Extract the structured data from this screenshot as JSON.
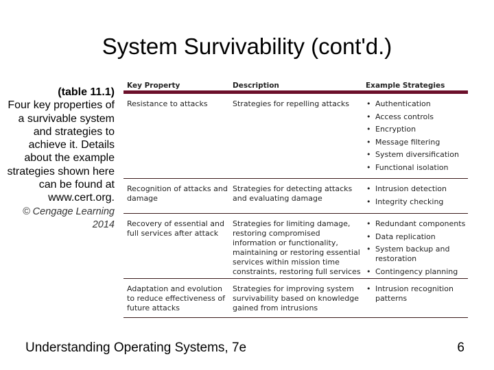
{
  "slide": {
    "title": "System Survivability (cont'd.)",
    "caption": {
      "label": "(table 11.1)",
      "text": "Four key properties of a survivable system and strategies to achieve it. Details about the example strategies shown here can be found at www.cert.org.",
      "credit": "© Cengage Learning 2014"
    },
    "footer": {
      "book": "Understanding Operating Systems, 7e",
      "page_number": "6"
    }
  },
  "table": {
    "header_color": "#6b0f2a",
    "columns": [
      "Key Property",
      "Description",
      "Example Strategies"
    ],
    "rows": [
      {
        "property": "Resistance to attacks",
        "description": "Strategies for repelling attacks",
        "strategies": [
          "Authentication",
          "Access controls",
          "Encryption",
          "Message filtering",
          "System diversification",
          "Functional isolation"
        ]
      },
      {
        "property": "Recognition of attacks and damage",
        "description": "Strategies for detecting attacks and evaluating damage",
        "strategies": [
          "Intrusion detection",
          "Integrity checking"
        ]
      },
      {
        "property": "Recovery of essential and full services after attack",
        "description": "Strategies for limiting damage, restoring compromised information or functionality, maintaining or restoring essential services within mission time constraints, restoring full services",
        "strategies": [
          "Redundant components",
          "Data replication",
          "System backup and restoration",
          "Contingency planning"
        ]
      },
      {
        "property": "Adaptation and evolution to reduce effectiveness of future attacks",
        "description": "Strategies for improving system survivability based on knowledge gained from intrusions",
        "strategies": [
          "Intrusion recognition patterns"
        ]
      }
    ]
  }
}
